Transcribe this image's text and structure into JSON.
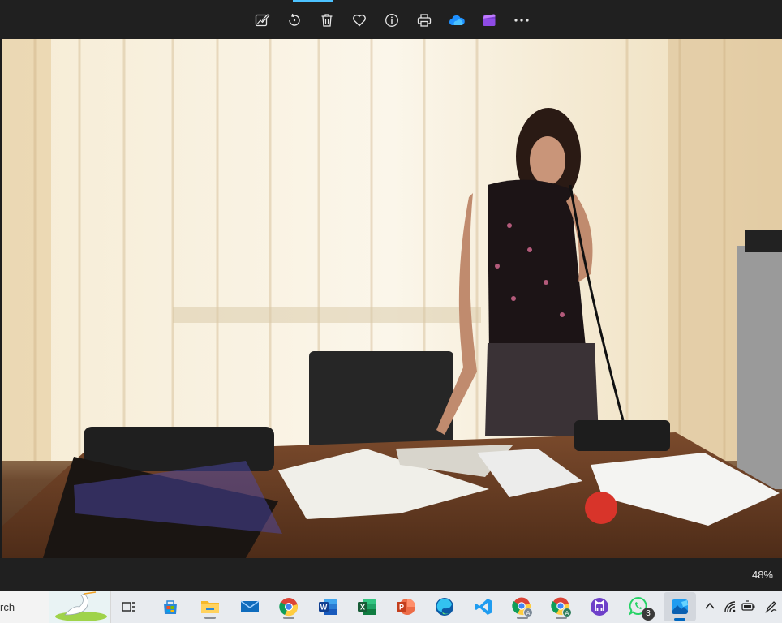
{
  "toolbar": {
    "buttons": [
      {
        "name": "edit-image-button",
        "icon": "edit-image-icon"
      },
      {
        "name": "rotate-button",
        "icon": "rotate-icon"
      },
      {
        "name": "delete-button",
        "icon": "trash-icon"
      },
      {
        "name": "favorite-button",
        "icon": "heart-icon"
      },
      {
        "name": "file-info-button",
        "icon": "info-icon"
      },
      {
        "name": "print-button",
        "icon": "printer-icon"
      },
      {
        "name": "onedrive-button",
        "icon": "cloud-icon"
      },
      {
        "name": "clipchamp-button",
        "icon": "clipchamp-icon"
      },
      {
        "name": "see-more-button",
        "icon": "more-icon"
      }
    ]
  },
  "viewer": {
    "zoom_label": "48%"
  },
  "taskbar": {
    "search_text": "rch",
    "apps": [
      {
        "name": "task-view",
        "icon": "task-view-icon"
      },
      {
        "name": "microsoft-store",
        "icon": "store-icon"
      },
      {
        "name": "file-explorer",
        "icon": "folder-icon"
      },
      {
        "name": "mail",
        "icon": "mail-icon"
      },
      {
        "name": "chrome",
        "icon": "chrome-icon"
      },
      {
        "name": "word",
        "icon": "word-icon"
      },
      {
        "name": "excel",
        "icon": "excel-icon"
      },
      {
        "name": "powerpoint",
        "icon": "powerpoint-icon"
      },
      {
        "name": "edge",
        "icon": "edge-icon"
      },
      {
        "name": "vscode",
        "icon": "vscode-icon"
      },
      {
        "name": "chrome-profile-a",
        "icon": "chrome-profile-icon"
      },
      {
        "name": "chrome-profile-b",
        "icon": "chrome-profile-icon"
      },
      {
        "name": "github-desktop",
        "icon": "github-icon"
      },
      {
        "name": "whatsapp",
        "icon": "whatsapp-icon",
        "badge": "3"
      },
      {
        "name": "photos",
        "icon": "photos-icon"
      }
    ],
    "tray": [
      {
        "name": "show-hidden-icons",
        "icon": "chevron-up-icon"
      },
      {
        "name": "network",
        "icon": "wifi-icon"
      },
      {
        "name": "battery",
        "icon": "battery-icon"
      },
      {
        "name": "pen",
        "icon": "pen-icon"
      }
    ]
  },
  "colors": {
    "toolbar_bg": "#202020",
    "accent": "#4cc2ff",
    "taskbar_bg": "#e8ebef"
  }
}
